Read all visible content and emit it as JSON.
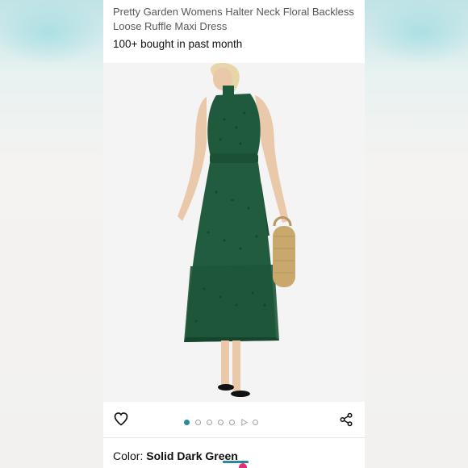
{
  "product": {
    "title": "Pretty Garden Womens Halter Neck Floral Backless Loose Ruffle Maxi Dress",
    "bought_text": "100+ bought in past month"
  },
  "gallery": {
    "image_count": 7,
    "active_index": 0,
    "video_index": 5
  },
  "icons": {
    "wishlist": "heart-icon",
    "share": "share-icon"
  },
  "variant": {
    "color_label": "Color:",
    "color_value": "Solid Dark Green"
  },
  "colors": {
    "accent": "#2a8a99",
    "text": "#0f1111",
    "muted_text": "#565959",
    "dress": "#1f5a3c"
  }
}
